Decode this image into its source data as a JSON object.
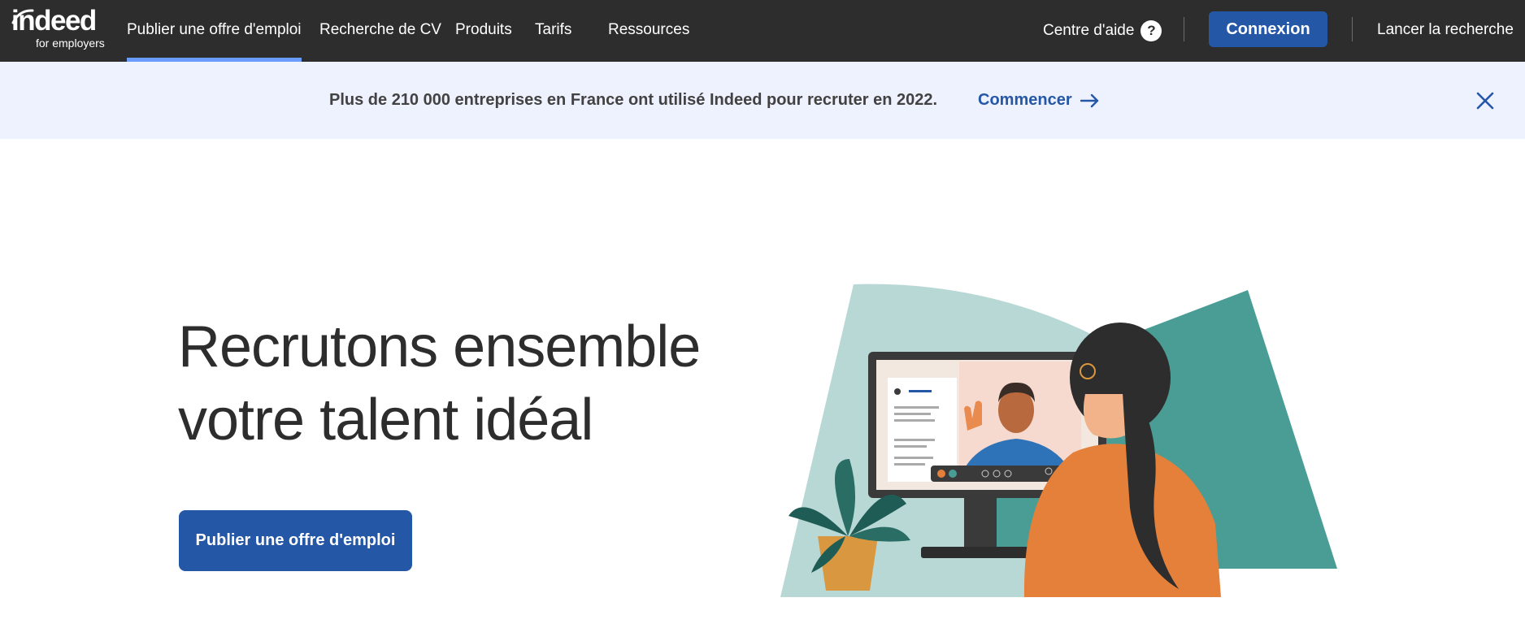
{
  "header": {
    "logo_word": "indeed",
    "logo_sub": "for employers",
    "nav": [
      {
        "label": "Publier une offre d'emploi",
        "active": true
      },
      {
        "label": "Recherche de CV"
      },
      {
        "label": "Produits"
      },
      {
        "label": "Tarifs"
      },
      {
        "label": "Ressources"
      }
    ],
    "help_label": "Centre d'aide",
    "help_icon": "question-circle-icon",
    "login_label": "Connexion",
    "search_label": "Lancer la recherche"
  },
  "banner": {
    "text": "Plus de 210 000 entreprises en France ont utilisé Indeed pour recruter en 2022.",
    "link_label": "Commencer",
    "link_icon": "arrow-right-icon",
    "close_icon": "close-icon"
  },
  "hero": {
    "title_line1": "Recrutons ensemble",
    "title_line2": "votre talent idéal",
    "cta_label": "Publier une offre d'emploi"
  },
  "colors": {
    "nav_bg": "#2d2d2d",
    "accent": "#2557a7",
    "active_underline": "#6a9cff",
    "banner_bg": "#eef1fe"
  }
}
